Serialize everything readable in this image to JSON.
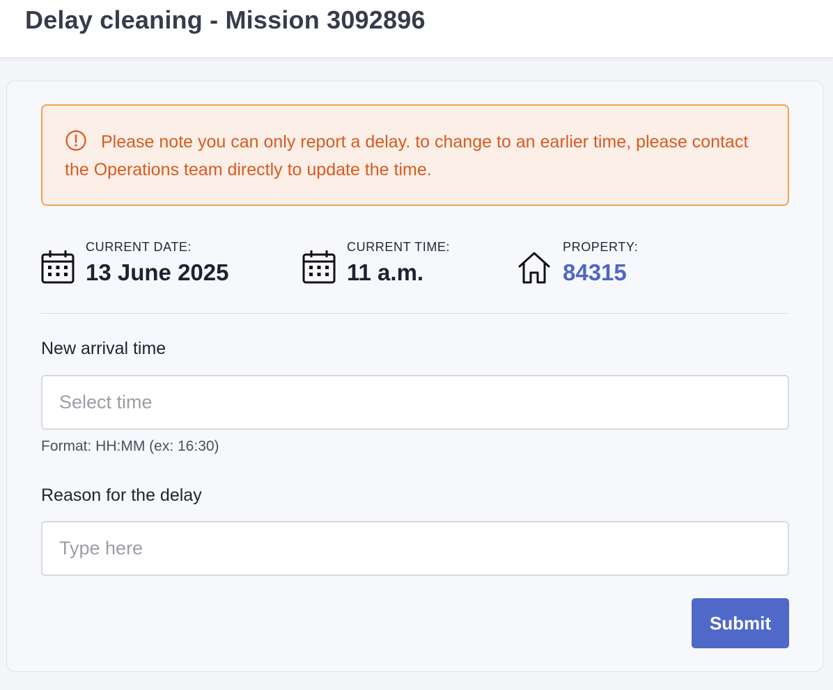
{
  "header": {
    "title": "Delay cleaning - Mission 3092896"
  },
  "alert": {
    "icon": "alert-circle-icon",
    "message": "Please note you can only report a delay. to change to an earlier time, please contact the Operations team directly to update the time.",
    "text_color": "#d95a1f",
    "border_color": "#eea24f",
    "background_color": "#fbefe8"
  },
  "info": {
    "date": {
      "icon": "calendar-icon",
      "label": "CURRENT DATE:",
      "value": "13 June 2025"
    },
    "time": {
      "icon": "calendar-icon",
      "label": "CURRENT TIME:",
      "value": "11 a.m."
    },
    "property": {
      "icon": "house-icon",
      "label": "PROPERTY:",
      "value": "84315",
      "link_color": "#4f67c6"
    }
  },
  "form": {
    "arrival": {
      "label": "New arrival time",
      "placeholder": "Select time",
      "value": "",
      "hint": "Format: HH:MM (ex: 16:30)"
    },
    "reason": {
      "label": "Reason for the delay",
      "placeholder": "Type here",
      "value": ""
    },
    "submit_label": "Submit",
    "accent_color": "#5068c7"
  }
}
